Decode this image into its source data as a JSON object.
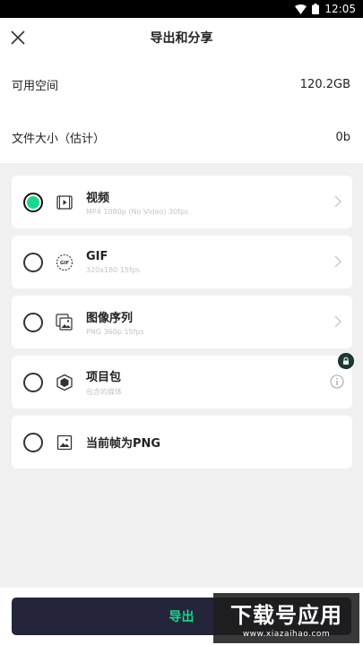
{
  "status_bar": {
    "time": "12:05"
  },
  "header": {
    "title": "导出和分享"
  },
  "info": {
    "rows": [
      {
        "label": "可用空间",
        "value": "120.2GB"
      },
      {
        "label": "文件大小（估计）",
        "value": "0b"
      }
    ]
  },
  "options": [
    {
      "title": "视频",
      "subtitle": "MP4 1080p (No Video) 30fps",
      "icon": "video-icon",
      "selected": true,
      "trailing": "chevron"
    },
    {
      "title": "GIF",
      "subtitle": "320x180 15fps",
      "icon": "gif-icon",
      "selected": false,
      "trailing": "chevron"
    },
    {
      "title": "图像序列",
      "subtitle": "PNG 360p 15fps",
      "icon": "image-sequence-icon",
      "selected": false,
      "trailing": "chevron"
    },
    {
      "title": "项目包",
      "subtitle": "包含的媒体",
      "icon": "package-icon",
      "selected": false,
      "trailing": "info",
      "badge": "lock-icon"
    },
    {
      "title": "当前帧为PNG",
      "subtitle": "",
      "icon": "image-icon",
      "selected": false,
      "trailing": "none"
    }
  ],
  "export_button": {
    "label": "导出"
  },
  "watermark": {
    "main": "下载号应用",
    "url": "www.xiazaihao.com"
  },
  "colors": {
    "accent": "#19d88d",
    "button_bg": "#24253a",
    "background": "#f0f0f0"
  }
}
